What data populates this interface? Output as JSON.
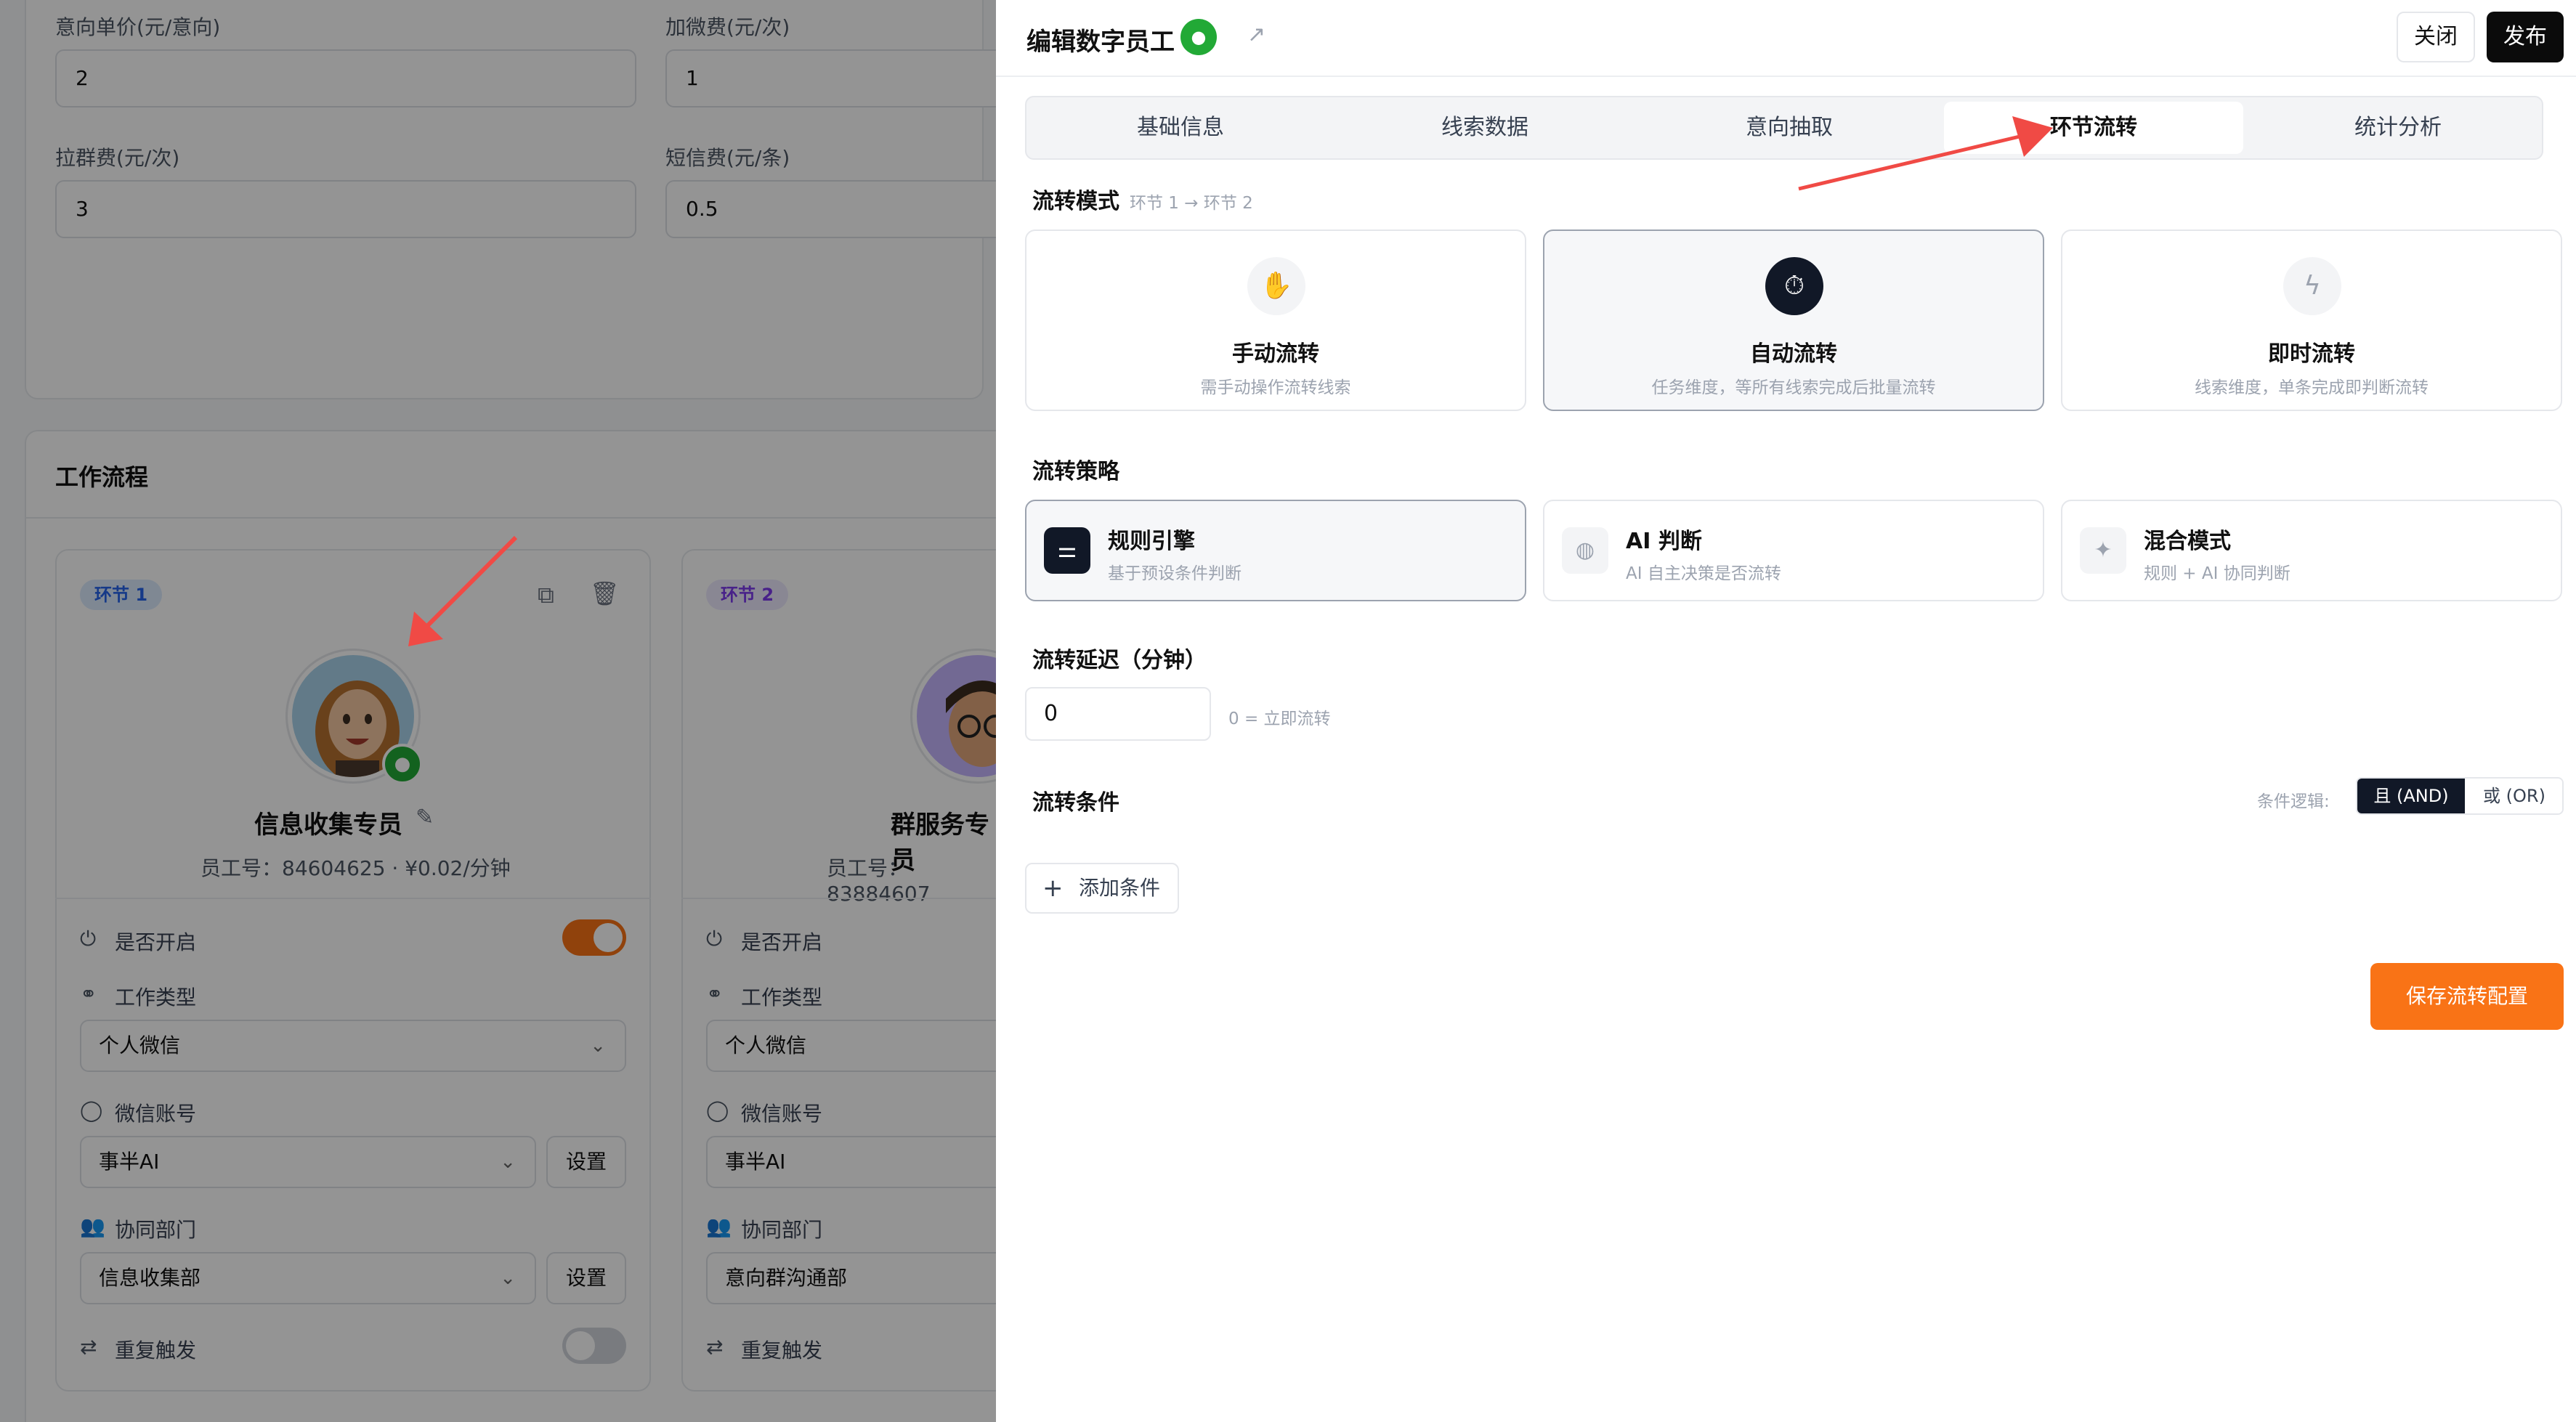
{
  "background": {
    "fields": [
      {
        "label": "意向单价(元/意向)",
        "value": "2"
      },
      {
        "label": "加微费(元/次)",
        "value": "1"
      },
      {
        "label": "拉群费(元/次)",
        "value": "3"
      },
      {
        "label": "短信费(元/条)",
        "value": "0.5"
      }
    ],
    "workflow_title": "工作流程",
    "card1": {
      "stage": "环节 1",
      "name": "信息收集专员",
      "meta": "员工号：84604625 · ¥0.02/分钟",
      "enabled_label": "是否开启",
      "work_type_label": "工作类型",
      "work_type_value": "个人微信",
      "wechat_label": "微信账号",
      "wechat_value": "事半AI",
      "dept_label": "协同部门",
      "dept_value": "信息收集部",
      "repeat_label": "重复触发",
      "set_label": "设置",
      "enabled": true,
      "repeat": false
    },
    "card2": {
      "stage": "环节 2",
      "name": "群服务专员",
      "meta": "员工号：83884607",
      "enabled_label": "是否开启",
      "work_type_label": "工作类型",
      "work_type_value": "个人微信",
      "wechat_label": "微信账号",
      "wechat_value": "事半AI",
      "dept_label": "协同部门",
      "dept_value": "意向群沟通部",
      "repeat_label": "重复触发"
    }
  },
  "drawer": {
    "title": "编辑数字员工",
    "close_label": "关闭",
    "publish_label": "发布",
    "tabs": [
      {
        "label": "基础信息",
        "active": false
      },
      {
        "label": "线索数据",
        "active": false
      },
      {
        "label": "意向抽取",
        "active": false
      },
      {
        "label": "环节流转",
        "active": true
      },
      {
        "label": "统计分析",
        "active": false
      }
    ],
    "mode_section": {
      "label": "流转模式",
      "sub": "环节 1 → 环节 2"
    },
    "modes": [
      {
        "title": "手动流转",
        "desc": "需手动操作流转线索",
        "icon": "hand-icon",
        "selected": false
      },
      {
        "title": "自动流转",
        "desc": "任务维度，等所有线索完成后批量流转",
        "icon": "timer-icon",
        "selected": true
      },
      {
        "title": "即时流转",
        "desc": "线索维度，单条完成即判断流转",
        "icon": "lightning-icon",
        "selected": false
      }
    ],
    "strategy_section": {
      "label": "流转策略"
    },
    "strategies": [
      {
        "title": "规则引擎",
        "desc": "基于预设条件判断",
        "icon": "sliders-icon",
        "selected": true
      },
      {
        "title": "AI 判断",
        "desc": "AI 自主决策是否流转",
        "icon": "brain-icon",
        "selected": false
      },
      {
        "title": "混合模式",
        "desc": "规则 + AI 协同判断",
        "icon": "sparkle-icon",
        "selected": false
      }
    ],
    "delay": {
      "label": "流转延迟（分钟）",
      "value": "0",
      "hint": "0 = 立即流转"
    },
    "conditions": {
      "label": "流转条件",
      "logic_label": "条件逻辑:",
      "and_label": "且 (AND)",
      "or_label": "或 (OR)",
      "add_label": "添加条件"
    },
    "save_label": "保存流转配置",
    "colors": {
      "accent": "#f97316",
      "dark": "#111827"
    }
  }
}
